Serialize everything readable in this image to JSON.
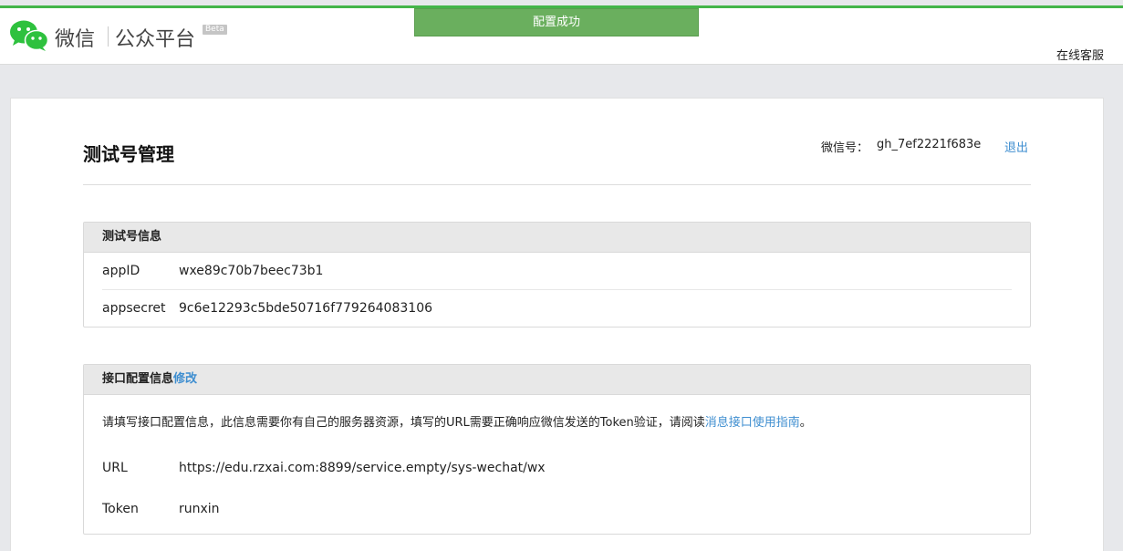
{
  "header": {
    "brand_wechat": "微信",
    "brand_platform": "公众平台",
    "beta": "Beta",
    "online_service": "在线客服"
  },
  "toast": {
    "message": "配置成功"
  },
  "page": {
    "title": "测试号管理",
    "account_label": "微信号：",
    "account_id": "gh_7ef2221f683e",
    "logout": "退出"
  },
  "test_account": {
    "heading": "测试号信息",
    "rows": [
      {
        "key": "appID",
        "value": "wxe89c70b7beec73b1"
      },
      {
        "key": "appsecret",
        "value": "9c6e12293c5bde50716f779264083106"
      }
    ]
  },
  "interface_config": {
    "heading": "接口配置信息",
    "edit": "修改",
    "description": "请填写接口配置信息，此信息需要你有自己的服务器资源，填写的URL需要正确响应微信发送的Token验证，请阅读",
    "guide_link": "消息接口使用指南",
    "description_end": "。",
    "rows": [
      {
        "key": "URL",
        "value": "https://edu.rzxai.com:8899/service.empty/sys-wechat/wx"
      },
      {
        "key": "Token",
        "value": "runxin"
      }
    ]
  },
  "colors": {
    "accent_green": "#44b549",
    "toast_green": "#6aaf5e",
    "link_blue": "#3e8ed0"
  },
  "icons": {
    "logo": "wechat-logo-icon"
  }
}
